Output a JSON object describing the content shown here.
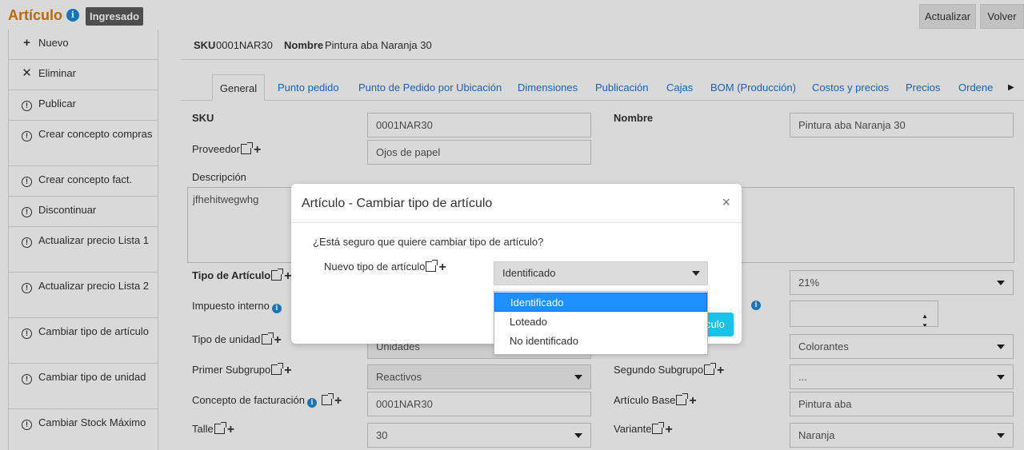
{
  "header": {
    "title": "Artículo",
    "status_badge": "Ingresado",
    "update_label": "Actualizar",
    "back_label": "Volver"
  },
  "sidebar": {
    "items": [
      {
        "label": "Nuevo"
      },
      {
        "label": "Eliminar"
      },
      {
        "label": "Publicar"
      },
      {
        "label": "Crear concepto compras"
      },
      {
        "label": "Crear concepto fact."
      },
      {
        "label": "Discontinuar"
      },
      {
        "label": "Actualizar precio Lista 1"
      },
      {
        "label": "Actualizar precio Lista 2"
      },
      {
        "label": "Cambiar tipo de artículo"
      },
      {
        "label": "Cambiar tipo de unidad"
      },
      {
        "label": "Cambiar Stock Máximo"
      }
    ]
  },
  "summary": {
    "sku_label": "SKU",
    "sku_value": "0001NAR30",
    "name_label": "Nombre",
    "name_value": "Pintura aba Naranja 30"
  },
  "tabs": [
    "General",
    "Punto pedido",
    "Punto de Pedido por Ubicación",
    "Dimensiones",
    "Publicación",
    "Cajas",
    "BOM (Producción)",
    "Costos y precios",
    "Precios",
    "Ordene"
  ],
  "form": {
    "sku_label": "SKU",
    "sku_value": "0001NAR30",
    "nombre_label": "Nombre",
    "nombre_value": "Pintura aba Naranja 30",
    "proveedor_label": "Proveedor",
    "proveedor_value": "Ojos de papel",
    "descripcion_label": "Descripción",
    "descripcion_value": "jfhehitwegwhg",
    "tipo_articulo_label": "Tipo de Artículo",
    "impuesto_interno_label": "Impuesto interno",
    "iva_value": "21%",
    "tipo_unidad_label": "Tipo de unidad",
    "tipo_unidad_value": "Unidades",
    "grupo_value": "Colorantes",
    "primer_subgrupo_label": "Primer Subgrupo",
    "primer_subgrupo_value": "Reactivos",
    "segundo_subgrupo_label": "Segundo Subgrupo",
    "segundo_subgrupo_value": "...",
    "concepto_fact_label": "Concepto de facturación",
    "concepto_fact_value": "0001NAR30",
    "articulo_base_label": "Artículo Base",
    "articulo_base_value": "Pintura aba",
    "talle_label": "Talle",
    "talle_value": "30",
    "variante_label": "Variante",
    "variante_value": "Naranja"
  },
  "modal": {
    "title": "Artículo - Cambiar tipo de artículo",
    "question": "¿Está seguro que quiere cambiar tipo de artículo?",
    "field_label": "Nuevo tipo de artículo",
    "selected": "Identificado",
    "options": [
      "Identificado",
      "Loteado",
      "No identificado"
    ],
    "confirm_partial": "culo"
  }
}
